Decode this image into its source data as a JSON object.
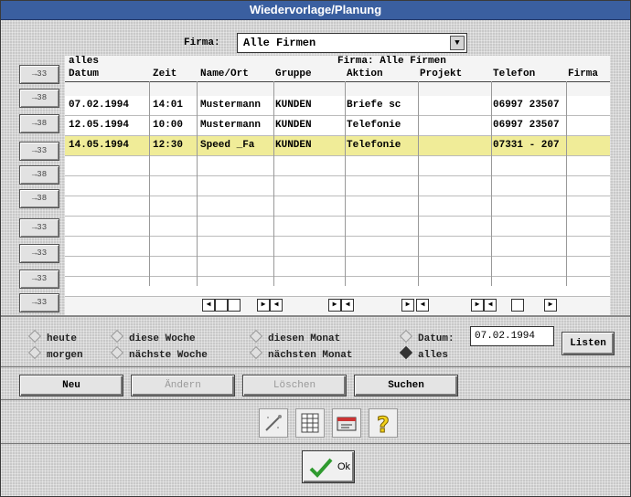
{
  "window": {
    "title": "Wiedervorlage/Planung"
  },
  "filter": {
    "firma_label": "Firma:",
    "firma_value": "Alle Firmen"
  },
  "sidebar_buttons": [
    "→33",
    "→38",
    "→38",
    "→33",
    "→38",
    "→38",
    "→33",
    "→33",
    "→33",
    "→33"
  ],
  "grid": {
    "info_left": "alles",
    "info_right": "Firma: Alle Firmen",
    "headers": [
      "Datum",
      "Zeit",
      "Name/Ort",
      "Gruppe",
      "Aktion",
      "Projekt",
      "Telefon",
      "Firma"
    ],
    "rows": [
      {
        "datum": "07.02.1994",
        "zeit": "14:01",
        "name": "Mustermann",
        "gruppe": "KUNDEN",
        "aktion": "Briefe sc",
        "projekt": "",
        "telefon": "06997 23507",
        "firma": ""
      },
      {
        "datum": "12.05.1994",
        "zeit": "10:00",
        "name": "Mustermann",
        "gruppe": "KUNDEN",
        "aktion": "Telefonie",
        "projekt": "",
        "telefon": "06997 23507",
        "firma": ""
      },
      {
        "datum": "14.05.1994",
        "zeit": "12:30",
        "name": "Speed _Fa",
        "gruppe": "KUNDEN",
        "aktion": "Telefonie",
        "projekt": "",
        "telefon": "07331 - 207",
        "firma": ""
      }
    ]
  },
  "radios": {
    "heute": "heute",
    "diese_woche": "diese Woche",
    "diesen_monat": "diesen Monat",
    "datum": "Datum:",
    "morgen": "morgen",
    "naechste_woche": "nächste Woche",
    "naechsten_monat": "nächsten Monat",
    "alles": "alles"
  },
  "date_value": "07.02.1994",
  "buttons": {
    "listen": "Listen",
    "neu": "Neu",
    "aendern": "Ändern",
    "loeschen": "Löschen",
    "suchen": "Suchen",
    "ok": "Ok"
  },
  "colors": {
    "selected_row": "#f0ec98",
    "titlebar": "#3a5fa0"
  }
}
